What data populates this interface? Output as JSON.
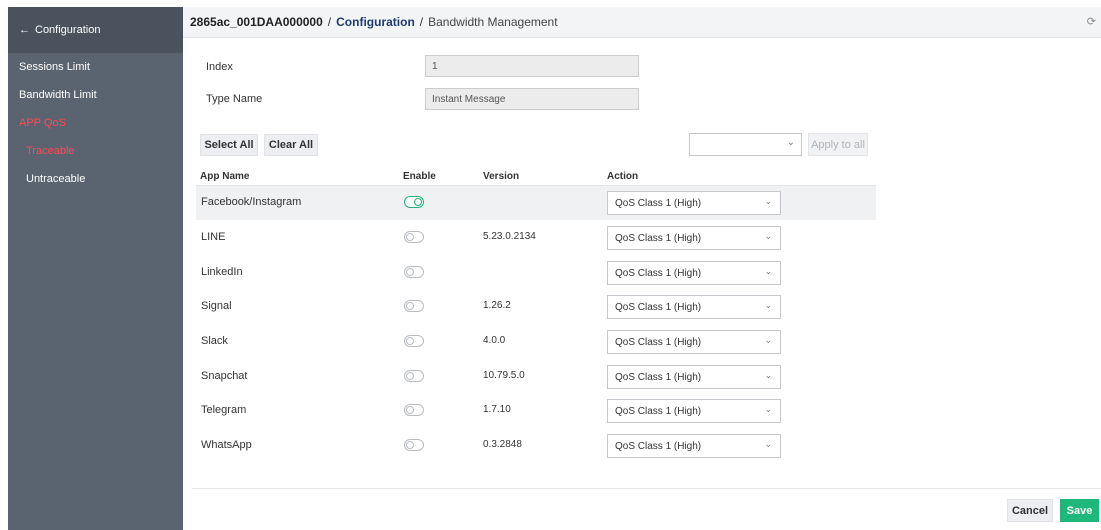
{
  "header": {
    "device": "2865ac_001DAA000000",
    "separator": "/",
    "section": "Configuration",
    "page": "Bandwidth Management",
    "refresh_icon": "refresh-icon"
  },
  "sidebar": {
    "back_label": "Configuration",
    "back_icon": "arrow-left-icon",
    "items": [
      {
        "label": "Sessions Limit"
      },
      {
        "label": "Bandwidth Limit"
      },
      {
        "label": "APP QoS"
      }
    ],
    "sub_items": [
      {
        "label": "Traceable"
      },
      {
        "label": "Untraceable"
      }
    ],
    "active_color": "#ff4b55"
  },
  "form": {
    "index_label": "Index",
    "index_value": "1",
    "type_label": "Type Name",
    "type_value": "Instant Message"
  },
  "toolbar": {
    "select_all": "Select All",
    "clear_all": "Clear All",
    "class_select_value": "",
    "apply_all": "Apply to all"
  },
  "table": {
    "columns": [
      "App Name",
      "Enable",
      "Version",
      "Action"
    ],
    "rows": [
      {
        "name": "Facebook/Instagram",
        "enabled": true,
        "version": "",
        "action": "QoS Class 1 (High)"
      },
      {
        "name": "LINE",
        "enabled": false,
        "version": "5.23.0.2134",
        "action": "QoS Class 1 (High)"
      },
      {
        "name": "LinkedIn",
        "enabled": false,
        "version": "",
        "action": "QoS Class 1 (High)"
      },
      {
        "name": "Signal",
        "enabled": false,
        "version": "1.26.2",
        "action": "QoS Class 1 (High)"
      },
      {
        "name": "Slack",
        "enabled": false,
        "version": "4.0.0",
        "action": "QoS Class 1 (High)"
      },
      {
        "name": "Snapchat",
        "enabled": false,
        "version": "10.79.5.0",
        "action": "QoS Class 1 (High)"
      },
      {
        "name": "Telegram",
        "enabled": false,
        "version": "1.7.10",
        "action": "QoS Class 1 (High)"
      },
      {
        "name": "WhatsApp",
        "enabled": false,
        "version": "0.3.2848",
        "action": "QoS Class 1 (High)"
      }
    ]
  },
  "footer": {
    "cancel": "Cancel",
    "save": "Save"
  },
  "colors": {
    "sidebar_bg": "#5a6370",
    "accent_green": "#1eb87a",
    "active_red": "#ff4b55",
    "breadcrumb_blue": "#1f3c6e"
  }
}
